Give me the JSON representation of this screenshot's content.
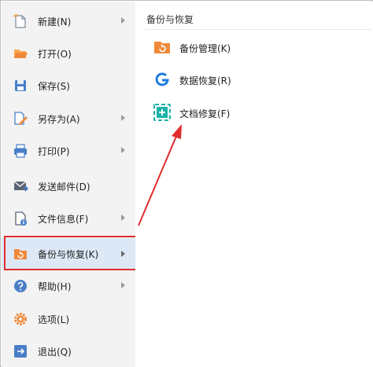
{
  "menu": {
    "items": [
      {
        "label": "新建(N)",
        "icon": "new-document-icon",
        "has_submenu": true
      },
      {
        "label": "打开(O)",
        "icon": "open-folder-icon",
        "has_submenu": false
      },
      {
        "label": "保存(S)",
        "icon": "save-disk-icon",
        "has_submenu": false
      },
      {
        "label": "另存为(A)",
        "icon": "save-as-icon",
        "has_submenu": true
      },
      {
        "label": "打印(P)",
        "icon": "printer-icon",
        "has_submenu": true
      },
      {
        "label": "发送邮件(D)",
        "icon": "send-mail-icon",
        "has_submenu": false
      },
      {
        "label": "文件信息(F)",
        "icon": "file-info-icon",
        "has_submenu": true
      },
      {
        "label": "备份与恢复(K)",
        "icon": "backup-restore-icon",
        "has_submenu": true,
        "active": true
      },
      {
        "label": "帮助(H)",
        "icon": "help-icon",
        "has_submenu": true
      },
      {
        "label": "选项(L)",
        "icon": "gear-icon",
        "has_submenu": false
      },
      {
        "label": "退出(Q)",
        "icon": "exit-icon",
        "has_submenu": false
      }
    ]
  },
  "submenu": {
    "title": "备份与恢复",
    "items": [
      {
        "label": "备份管理(K)",
        "icon": "backup-manage-icon"
      },
      {
        "label": "数据恢复(R)",
        "icon": "data-recovery-icon"
      },
      {
        "label": "文档修复(F)",
        "icon": "document-repair-icon"
      }
    ]
  },
  "colors": {
    "highlight_border": "#e02d2d",
    "active_bg": "#dde8f7",
    "menu_bg": "#f3f3f3",
    "accent_orange": "#f0883a",
    "accent_blue": "#1e7be0",
    "accent_teal": "#19b3a6"
  }
}
